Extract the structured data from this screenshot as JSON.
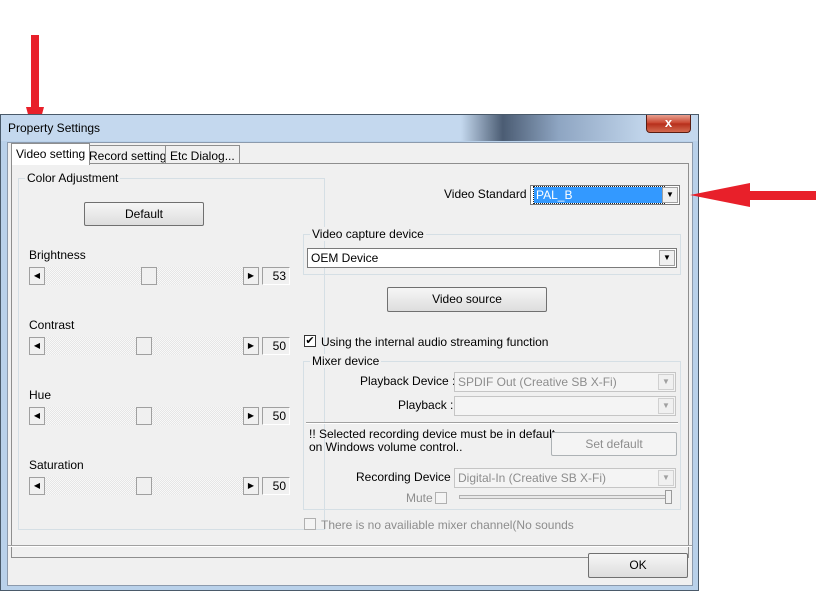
{
  "window": {
    "title": "Property Settings",
    "close_glyph": "x"
  },
  "tabs": [
    {
      "label": "Video setting",
      "active": true
    },
    {
      "label": "Record setting",
      "active": false
    },
    {
      "label": "Etc Dialog...",
      "active": false
    }
  ],
  "color_adjustment": {
    "legend": "Color Adjustment",
    "default_button": "Default",
    "sliders": [
      {
        "label": "Brightness",
        "value": "53",
        "level": 53
      },
      {
        "label": "Contrast",
        "value": "50",
        "level": 50
      },
      {
        "label": "Hue",
        "value": "50",
        "level": 50
      },
      {
        "label": "Saturation",
        "value": "50",
        "level": 50
      }
    ]
  },
  "video_standard": {
    "label": "Video Standard :",
    "value": "PAL_B"
  },
  "capture": {
    "legend": "Video capture device",
    "value": "OEM Device",
    "source_button": "Video source"
  },
  "audio_streaming": {
    "label": "Using the internal audio streaming function",
    "checked": true
  },
  "mixer": {
    "legend": "Mixer device",
    "playback_device_label": "Playback Device :",
    "playback_device_value": "SPDIF Out (Creative SB X-Fi)",
    "playback_label": "Playback :",
    "playback_value": "",
    "note": "!! Selected recording device must be in default on Windows volume control..",
    "set_default_button": "Set default",
    "recording_device_label": "Recording Device :",
    "recording_device_value": "Digital-In (Creative SB X-Fi)",
    "mute_label": "Mute"
  },
  "no_mixer": {
    "label": "There is no availiable mixer channel(No sounds"
  },
  "footer": {
    "ok_button": "OK"
  },
  "colors": {
    "annotation_arrow": "#e8202a",
    "selection": "#3399ff"
  }
}
